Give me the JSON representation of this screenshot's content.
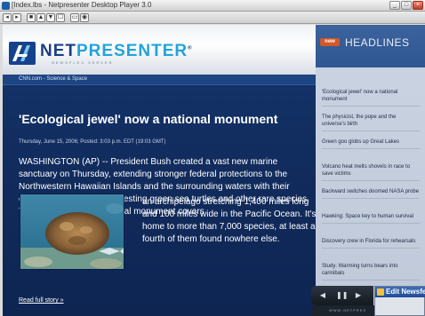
{
  "window": {
    "title": "[Index.lbs - Netpresenter Desktop Player 3.0",
    "minimize": "_",
    "maximize": "□",
    "close": "×"
  },
  "toolbar": {
    "buttons": [
      "◂",
      "▸",
      "■",
      "▲",
      "▼",
      "☐",
      "▭",
      "◉"
    ]
  },
  "brand": {
    "logo_main": "NET",
    "logo_accent": "PRESENTER",
    "logo_mark": "®",
    "tagline": "NEWSFLEX SERVER"
  },
  "article": {
    "section": "CNN.com - Science & Space",
    "headline": "'Ecological jewel' now a national monument",
    "dateline": "Thursday, June 15, 2006; Posted: 3:03 p.m. EDT (19:03 GMT)",
    "lead": "WASHINGTON (AP) -- President Bush created a vast new marine sanctuary on Thursday, extending stronger federal protections to the Northwestern Hawaiian Islands and the surrounding waters with their endangered monk seals, nesting green sea turtles and other rare species. The nation's newest national monument covers",
    "continuation": "an archipelago stretching 1,400 miles long and 100 miles wide in the Pacific Ocean. It's home to more than 7,000 species, at least a fourth of them found nowhere else.",
    "read_more": "Read full story »"
  },
  "sidebar": {
    "badge": "new",
    "title": "HEADLINES",
    "items": [
      "'Ecological jewel' now a national monument",
      "The physicist, the pope and the universe's birth",
      "Green goo globs up Great Lakes",
      "Volcano heat melts shovels in race to save victims",
      "Backward switches doomed NASA probe",
      "Hawking: Space key to human survival",
      "Discovery crew in Florida for rehearsals",
      "Study: Warming turns bears into cannibals"
    ]
  },
  "controls": {
    "prev": "◀",
    "pause": "❚❚",
    "next": "▶"
  },
  "footer": {
    "text": "WWW.NETPRES"
  },
  "ext_window": {
    "title": "Edit Newsfe"
  },
  "colors": {
    "main_bg": "#16376e",
    "accent": "#22a3d8",
    "badge": "#d25828"
  }
}
